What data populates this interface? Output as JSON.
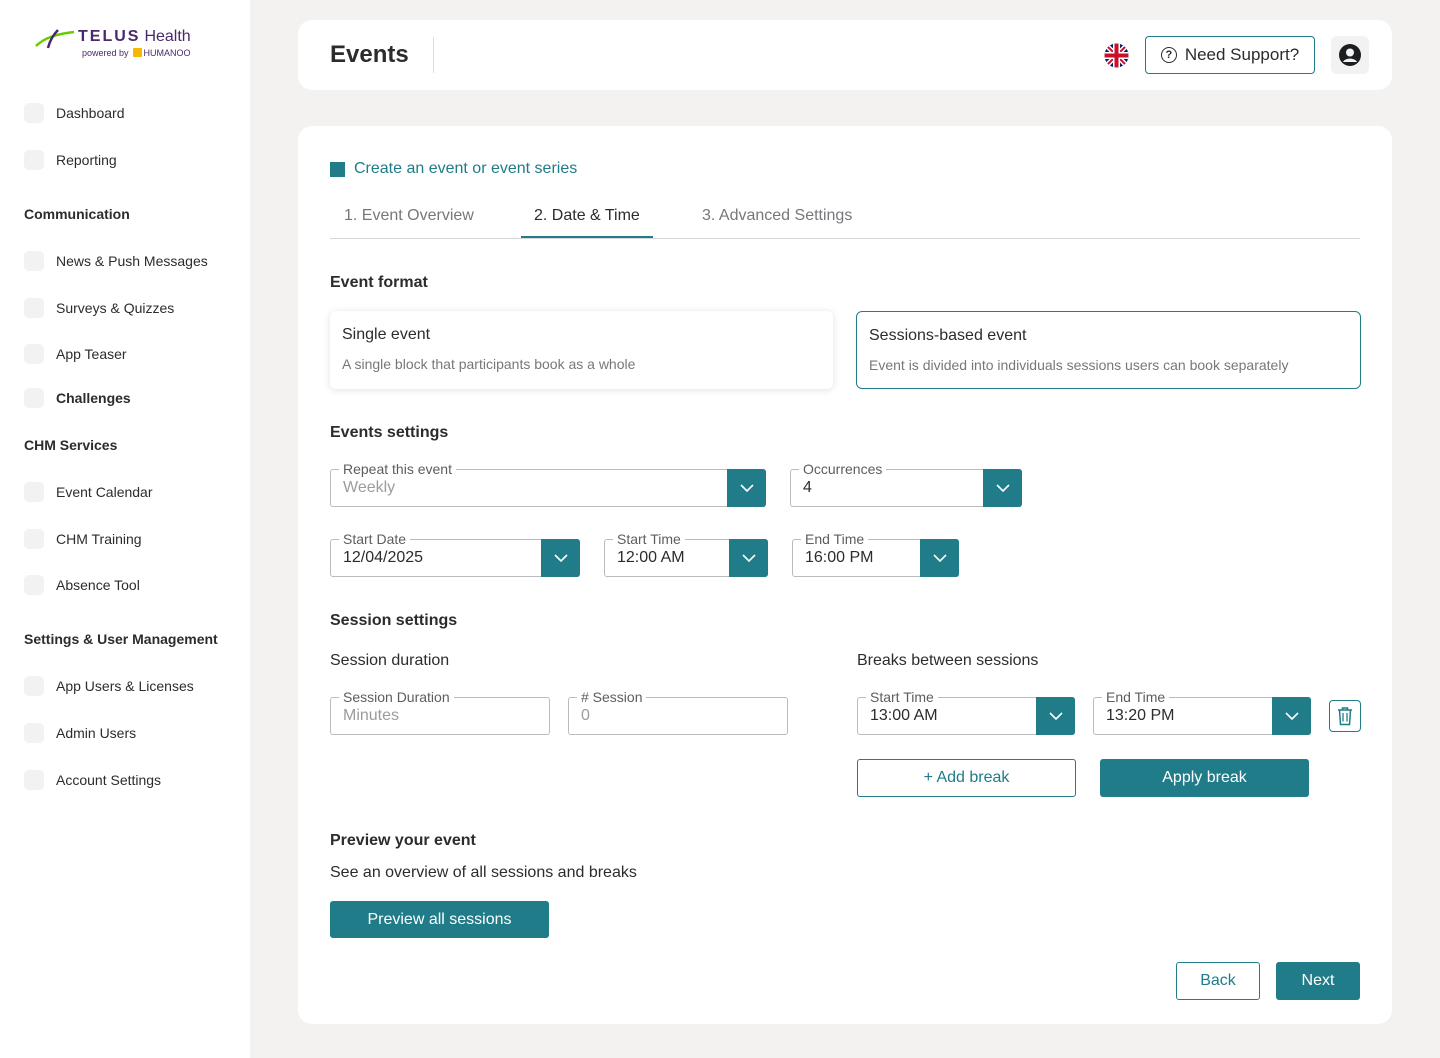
{
  "brand": {
    "name": "TELUS",
    "suffix": "Health",
    "powered_by": "powered by",
    "partner": "HUMANOO",
    "accent_color": "#1f7c88",
    "brand_purple": "#4b286d"
  },
  "sidebar": {
    "items_top": [
      {
        "label": "Dashboard",
        "icon": "dashboard-icon"
      },
      {
        "label": "Reporting",
        "icon": "reporting-icon"
      }
    ],
    "sections": [
      {
        "title": "Communication",
        "items": [
          "News & Push Messages",
          "Surveys & Quizzes",
          "App Teaser",
          "Challenges"
        ]
      },
      {
        "title": "CHM Services",
        "items": [
          "Event Calendar",
          "CHM Training",
          "Absence Tool"
        ]
      },
      {
        "title": "Settings & User Management",
        "items": [
          "App Users & Licenses",
          "Admin Users",
          "Account Settings"
        ]
      }
    ]
  },
  "header": {
    "title": "Events",
    "language_icon": "uk-flag-icon",
    "support_label": "Need Support?",
    "account_icon": "account-circle-icon"
  },
  "main": {
    "breadcrumb": "Create an event or event series",
    "tabs": [
      {
        "label": "1. Event Overview",
        "active": false
      },
      {
        "label": "2. Date & Time",
        "active": true
      },
      {
        "label": "3. Advanced Settings",
        "active": false
      }
    ],
    "event_format": {
      "heading": "Event format",
      "options": [
        {
          "title": "Single event",
          "description": "A single block that participants book as a whole",
          "selected": false
        },
        {
          "title": "Sessions-based event",
          "description": "Event is divided into individuals sessions users can book separately",
          "selected": true
        }
      ]
    },
    "events_settings": {
      "heading": "Events settings",
      "repeat": {
        "label": "Repeat this event",
        "value": "Weekly"
      },
      "occurrences": {
        "label": "Occurrences",
        "value": "4"
      },
      "start_date": {
        "label": "Start Date",
        "value": "12/04/2025"
      },
      "start_time": {
        "label": "Start Time",
        "value": "12:00 AM"
      },
      "end_time": {
        "label": "End Time",
        "value": "16:00 PM"
      }
    },
    "session_settings": {
      "heading": "Session settings",
      "duration_heading": "Session duration",
      "duration": {
        "label": "Session Duration",
        "placeholder": "Minutes"
      },
      "count": {
        "label": "# Session",
        "placeholder": "0"
      },
      "breaks_heading": "Breaks between sessions",
      "break_start": {
        "label": "Start Time",
        "value": "13:00 AM"
      },
      "break_end": {
        "label": "End Time",
        "value": "13:20 PM"
      },
      "add_break": "+ Add break",
      "apply_break": "Apply break"
    },
    "preview": {
      "heading": "Preview your event",
      "description": "See an overview of all sessions and breaks",
      "button": "Preview all sessions"
    },
    "footer": {
      "back": "Back",
      "next": "Next"
    }
  }
}
